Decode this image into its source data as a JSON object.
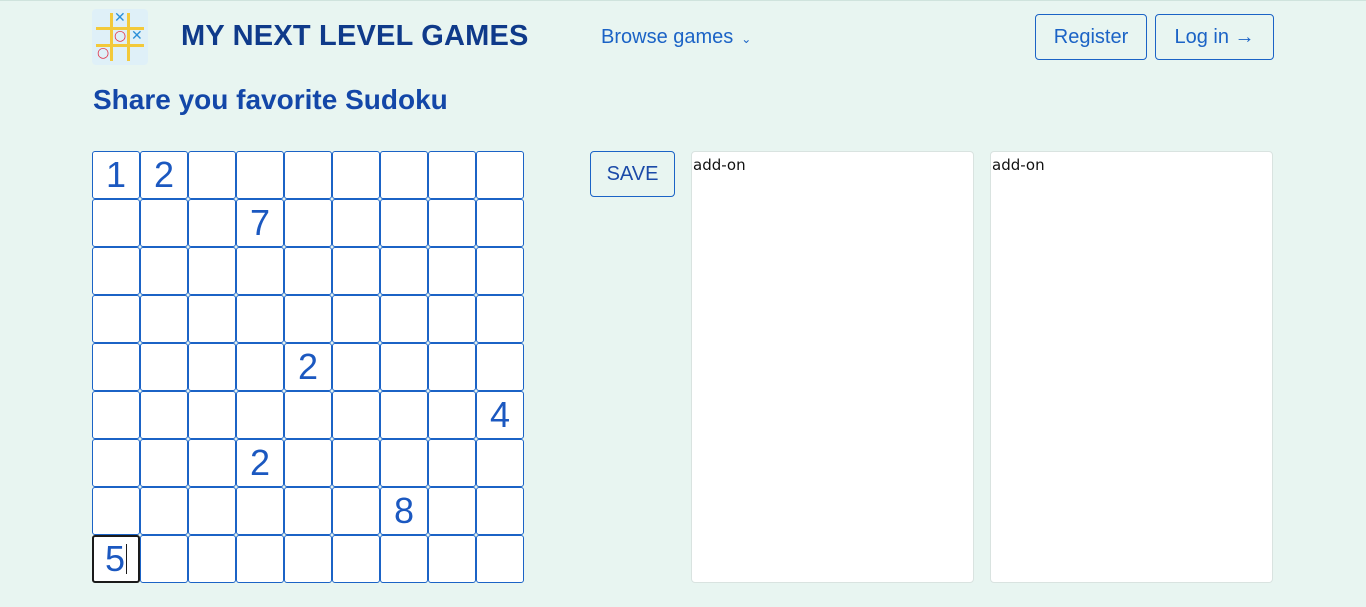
{
  "header": {
    "brand": "MY NEXT LEVEL GAMES",
    "browse_label": "Browse games",
    "register_label": "Register",
    "login_label": "Log in →"
  },
  "page": {
    "title": "Share you favorite Sudoku"
  },
  "sudoku": {
    "rows": [
      [
        "1",
        "2",
        "",
        "",
        "",
        "",
        "",
        "",
        ""
      ],
      [
        "",
        "",
        "",
        "7",
        "",
        "",
        "",
        "",
        ""
      ],
      [
        "",
        "",
        "",
        "",
        "",
        "",
        "",
        "",
        ""
      ],
      [
        "",
        "",
        "",
        "",
        "",
        "",
        "",
        "",
        ""
      ],
      [
        "",
        "",
        "",
        "",
        "2",
        "",
        "",
        "",
        ""
      ],
      [
        "",
        "",
        "",
        "",
        "",
        "",
        "",
        "",
        "4"
      ],
      [
        "",
        "",
        "",
        "2",
        "",
        "",
        "",
        "",
        ""
      ],
      [
        "",
        "",
        "",
        "",
        "",
        "",
        "8",
        "",
        ""
      ],
      [
        "5",
        "",
        "",
        "",
        "",
        "",
        "",
        "",
        ""
      ]
    ],
    "active_cell": [
      8,
      0
    ]
  },
  "actions": {
    "save_label": "SAVE"
  },
  "addons": [
    {
      "label": "add-on"
    },
    {
      "label": "add-on"
    }
  ],
  "colors": {
    "background": "#e8f5f1",
    "accent": "#1b63c6",
    "brand": "#0f3a8a"
  }
}
